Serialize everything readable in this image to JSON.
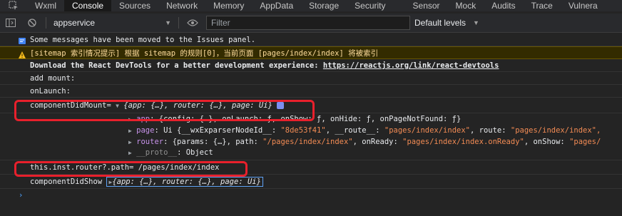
{
  "tabs": [
    {
      "label": "Wxml"
    },
    {
      "label": "Console",
      "active": true
    },
    {
      "label": "Sources"
    },
    {
      "label": "Network"
    },
    {
      "label": "Memory"
    },
    {
      "label": "AppData"
    },
    {
      "label": "Storage"
    },
    {
      "label": "Security"
    },
    {
      "label": "Sensor"
    },
    {
      "label": "Mock"
    },
    {
      "label": "Audits"
    },
    {
      "label": "Trace"
    },
    {
      "label": "Vulnera"
    }
  ],
  "toolbar": {
    "context": "appservice",
    "filter_placeholder": "Filter",
    "levels": "Default levels"
  },
  "console": {
    "issues_msg": "Some messages have been moved to the Issues panel.",
    "warn_msg": "[sitemap 索引情况提示] 根据 sitemap 的规则[0]，当前页面 [pages/index/index] 将被索引",
    "devtools_prefix": "Download the React DevTools for a better development experience: ",
    "devtools_link": "https://reactjs.org/link/react-devtools",
    "add_mount": "add mount:",
    "on_launch": "onLaunch:",
    "cdm_label": "componentDidMount=",
    "cdm_obj": "{app: {…}, router: {…}, page: Ui}",
    "app_key": "app",
    "app_val": ": {config: {…}, onLaunch: ƒ, onShow: ƒ, onHide: ƒ, onPageNotFound: ƒ}",
    "page_key": "page",
    "page_val_a": ": Ui {__wxExparserNodeId__: ",
    "page_val_b": "\"8de53f41\"",
    "page_val_c": ", __route__: ",
    "page_val_d": "\"pages/index/index\"",
    "page_val_e": ", route: ",
    "page_val_f": "\"pages/index/index\",",
    "router_key": "router",
    "router_val_a": ": {params: {…}, path: ",
    "router_val_b": "\"/pages/index/index\"",
    "router_val_c": ", onReady: ",
    "router_val_d": "\"pages/index/index.onReady\"",
    "router_val_e": ", onShow: ",
    "router_val_f": "\"pages/",
    "proto_key": "__proto__",
    "proto_val": ": Object",
    "path_line": "this.inst.router?.path= /pages/index/index",
    "cds_label": "componentDidShow",
    "cds_obj": "{app: {…}, router: {…}, page: Ui}",
    "prompt": "›"
  }
}
